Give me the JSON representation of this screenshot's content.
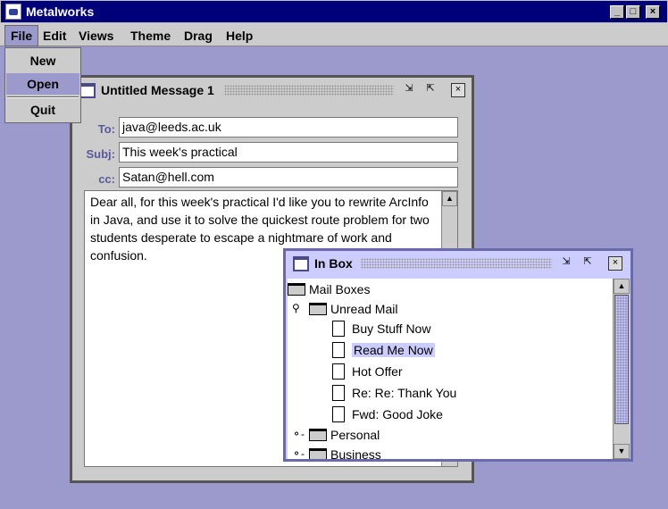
{
  "app": {
    "title": "Metalworks",
    "minimize": "_",
    "maximize": "□",
    "close": "×"
  },
  "menubar": [
    {
      "label": "File"
    },
    {
      "label": "Edit"
    },
    {
      "label": "Views"
    },
    {
      "label": "Theme"
    },
    {
      "label": "Drag"
    },
    {
      "label": "Help"
    }
  ],
  "file_menu": {
    "items": [
      {
        "label": "New"
      },
      {
        "label": "Open",
        "selected": true
      },
      {
        "label": "Quit"
      }
    ]
  },
  "message_window": {
    "title": "Untitled Message 1",
    "to_label": "To:",
    "to_value": "java@leeds.ac.uk",
    "subj_label": "Subj:",
    "subj_value": "This week's practical",
    "cc_label": "cc:",
    "cc_value": "Satan@hell.com",
    "body": "Dear all, for this week's practical I'd like you to rewrite ArcInfo in Java, and use it to solve the quickest route problem for two students desperate to escape a nightmare of work and confusion."
  },
  "inbox_window": {
    "title": "In Box",
    "tree": {
      "root": "Mail Boxes",
      "unread": "Unread Mail",
      "messages": [
        "Buy Stuff Now",
        "Read Me Now",
        "Hot Offer",
        "Re: Re: Thank You",
        "Fwd: Good Joke"
      ],
      "selected": "Read Me Now",
      "personal": "Personal",
      "business": "Business"
    }
  },
  "colors": {
    "desktop": "#9c9acc",
    "titlebar": "#00007b",
    "selection": "#ccccff"
  }
}
